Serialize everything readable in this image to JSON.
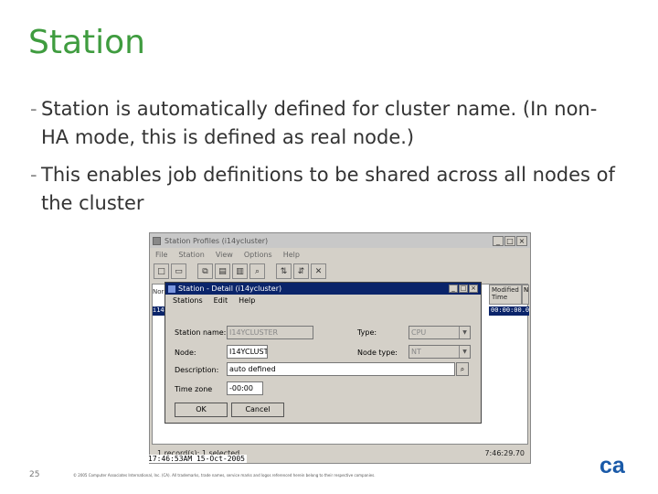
{
  "slide": {
    "title": "Station",
    "bullets": [
      {
        "dash": "-",
        "text": "Station is automatically defined for cluster name. (In non-HA mode, this is defined as real node.)"
      },
      {
        "dash": "-",
        "text": "This enables job definitions to be shared across all nodes of the cluster"
      }
    ],
    "page_number": "25",
    "copyright": "© 2005 Computer Associates International, Inc. (CA). All trademarks, trade names, service marks and logos referenced herein belong to their respective companies.",
    "logo_text": "ca",
    "logo_color": "#1a5aa8",
    "title_color": "#3f9c3f"
  },
  "outer_window": {
    "title": "Station Profiles (i14ycluster)",
    "menu": [
      "File",
      "Station",
      "View",
      "Options",
      "Help"
    ],
    "window_buttons": [
      "_",
      "□",
      "×"
    ],
    "toolbar_icons": [
      "new-icon",
      "open-icon",
      "copy-icon",
      "print-icon",
      "delete-icon",
      "find-icon",
      "sort-asc-icon",
      "sort-desc-icon",
      "close-list-icon"
    ],
    "list_header_left": "Nor",
    "list_row_left": "i14Y",
    "column_header": "Modified Time",
    "column_header_right": "N",
    "column_value": "00:00:00.0",
    "status_left": "1 record(s); 1 selected",
    "status_right": "7:46:29.70",
    "time_overlay": "17:46:53AM 15-Oct-2005"
  },
  "dialog": {
    "title": "Station - Detail (i14ycluster)",
    "menu": [
      "Stations",
      "Edit",
      "Help"
    ],
    "window_buttons": [
      "_",
      "□",
      "×"
    ],
    "station_name_label": "Station name:",
    "station_name_value": "I14YCLUSTER",
    "node_label": "Node:",
    "node_value": "I14YCLUST",
    "description_label": "Description:",
    "description_value": "auto defined",
    "time_zone_label": "Time zone",
    "time_zone_value": "-00:00",
    "type_label": "Type:",
    "type_value": "CPU",
    "node_type_label": "Node type:",
    "node_type_value": "NT",
    "ok_label": "OK",
    "cancel_label": "Cancel"
  }
}
